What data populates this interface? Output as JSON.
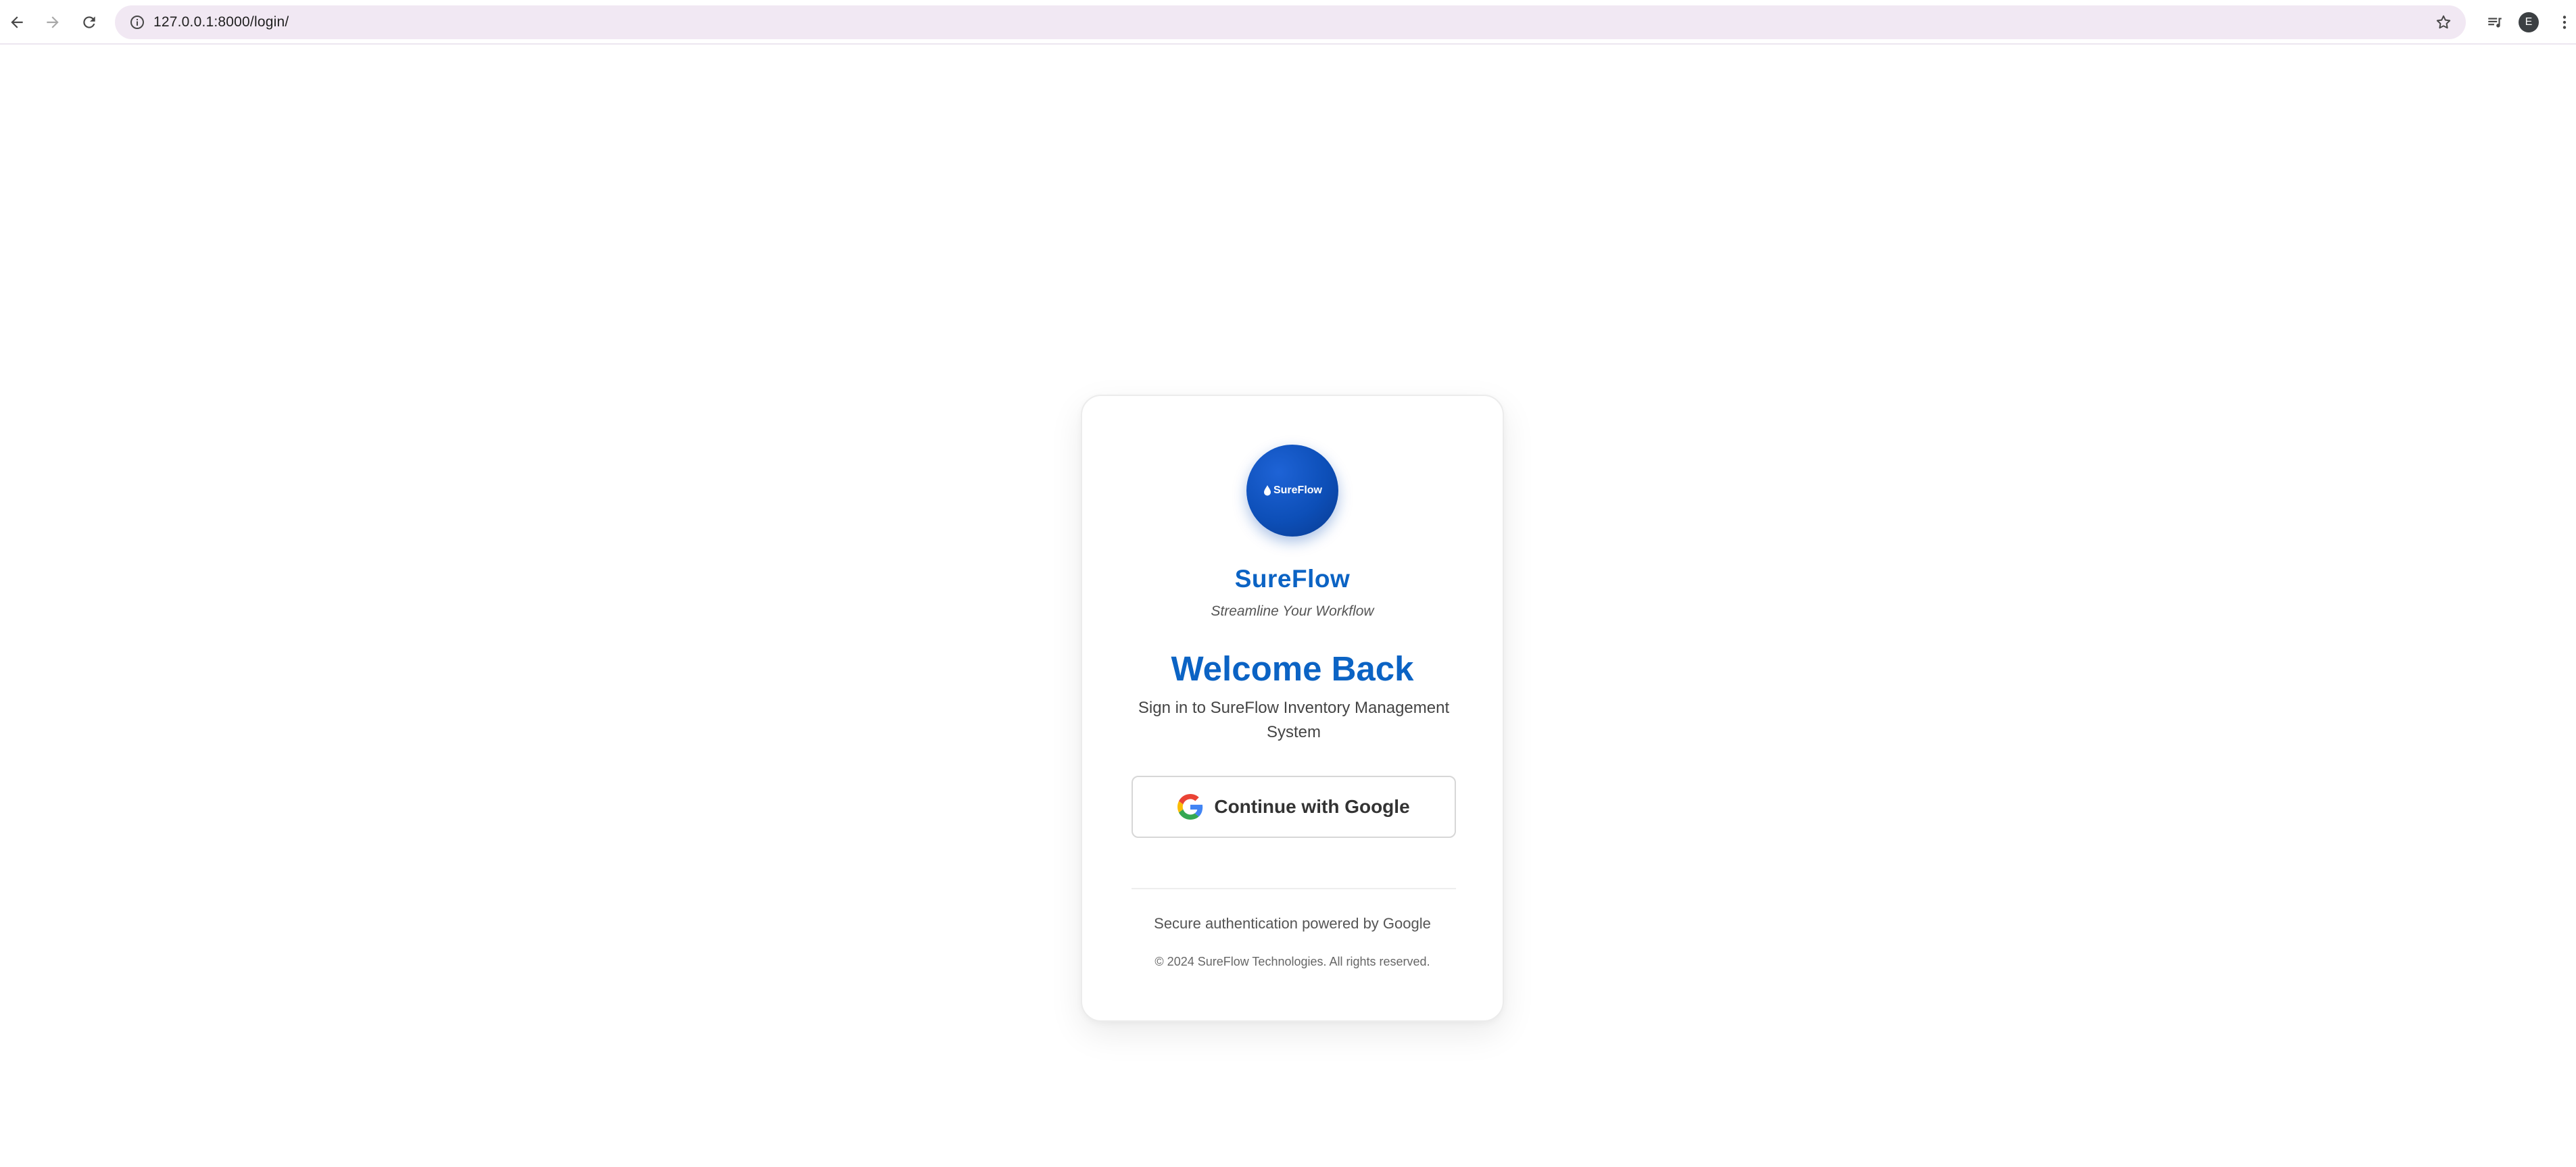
{
  "browser": {
    "url": "127.0.0.1:8000/login/",
    "profile_initial": "E"
  },
  "login": {
    "logo_text": "SureFlow",
    "brand_name": "SureFlow",
    "tagline": "Streamline Your Workflow",
    "heading": "Welcome Back",
    "subtitle": "Sign in to SureFlow Inventory Management System",
    "google_button_label": "Continue with Google",
    "secure_text": "Secure authentication powered by Google",
    "copyright": "© 2024 SureFlow Technologies. All rights reserved."
  },
  "colors": {
    "brand_blue": "#0b63c4",
    "logo_blue": "#0d4fb8",
    "omnibox_bg": "#f1e8f3"
  }
}
